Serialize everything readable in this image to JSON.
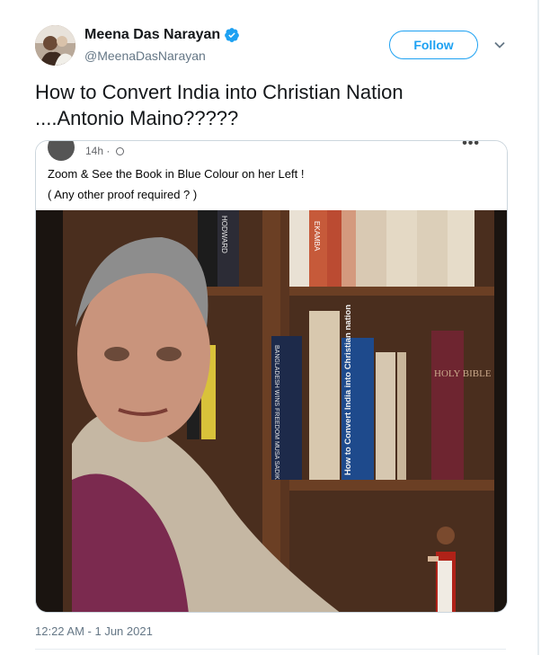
{
  "author": {
    "display_name": "Meena Das Narayan",
    "handle": "@MeenaDasNarayan",
    "verified": true
  },
  "follow_label": "Follow",
  "tweet_text": "How to Convert India into Christian Nation\n....Antonio Maino?????",
  "quoted_post": {
    "time": "14h · ",
    "more": "•••",
    "line1": "Zoom & See the Book in Blue Colour on her Left !",
    "line2": "( Any other proof required ? )"
  },
  "photo_text": {
    "book_blue": "How to Convert India into Christian nation",
    "book_dark": "BANGLADESH WINS FREEDOM MUSA SADIK",
    "bible": "HOLY BIBLE",
    "book_top": "HODWARD",
    "book_red": "EKAMBA"
  },
  "timestamp": "12:22 AM - 1 Jun 2021",
  "colors": {
    "accent": "#1da1f2",
    "secondary_text": "#657786"
  }
}
